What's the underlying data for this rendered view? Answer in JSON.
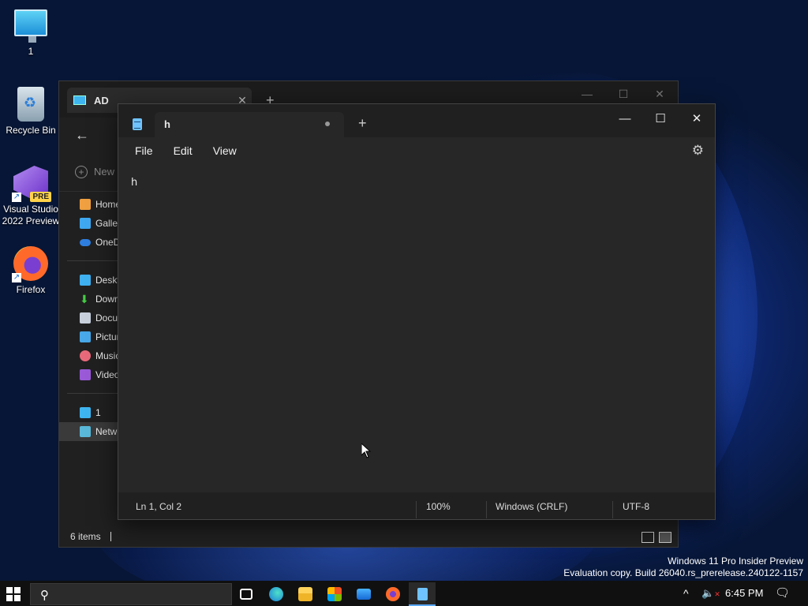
{
  "desktop": {
    "icons": [
      {
        "label": "1"
      },
      {
        "label": "Recycle Bin"
      },
      {
        "label": "Visual Studio 2022 Preview",
        "badge": "PRE"
      },
      {
        "label": "Firefox"
      }
    ]
  },
  "explorer": {
    "tab_title": "AD",
    "new_label": "New",
    "nav": {
      "items": [
        "Home",
        "Gallery",
        "OneDrive",
        "Desktop",
        "Downloads",
        "Documents",
        "Pictures",
        "Music",
        "Videos",
        "1",
        "Network"
      ]
    },
    "status": "6 items"
  },
  "notepad": {
    "tab_title": "h",
    "menu": [
      "File",
      "Edit",
      "View"
    ],
    "content": "h",
    "status": {
      "position": "Ln 1, Col 2",
      "zoom": "100%",
      "line_ending": "Windows (CRLF)",
      "encoding": "UTF-8"
    },
    "controls": {
      "minimize": "—",
      "maximize": "☐",
      "close": "✕"
    }
  },
  "watermark": {
    "line1": "Windows 11 Pro Insider Preview",
    "line2": "Evaluation copy. Build 26040.rs_prerelease.240122-1157"
  },
  "taskbar": {
    "clock": "6:45 PM",
    "apps": [
      "task-view",
      "edge",
      "file-explorer",
      "store",
      "mail",
      "firefox",
      "notepad"
    ]
  },
  "colors": {
    "accent": "#5aa8ff",
    "window_bg": "#272727",
    "titlebar_bg": "#202020"
  }
}
